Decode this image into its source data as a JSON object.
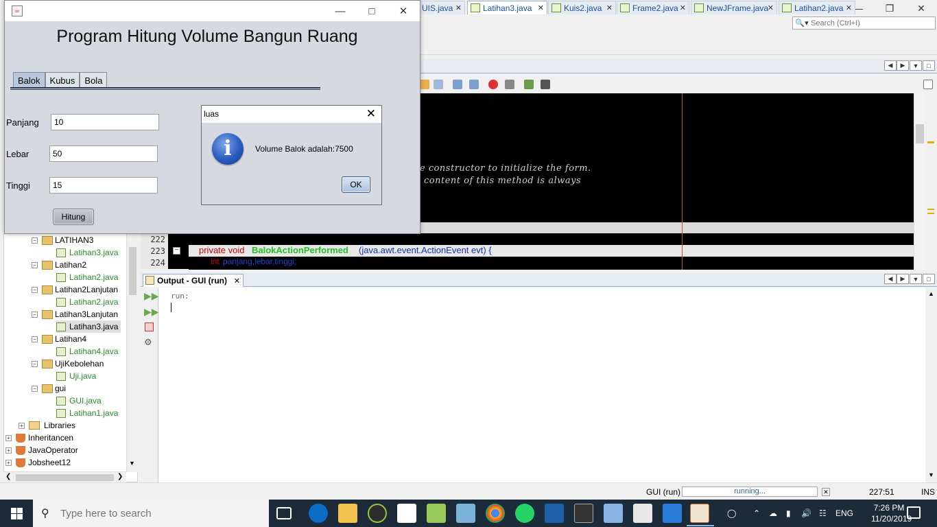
{
  "ide": {
    "search_placeholder": "Search (Ctrl+I)",
    "editor_tabs": [
      {
        "label": "UIS.java"
      },
      {
        "label": "Latihan3.java"
      },
      {
        "label": "Kuis2.java"
      },
      {
        "label": "Frame2.java"
      },
      {
        "label": "NewJFrame.java"
      },
      {
        "label": "Latihan2.java"
      }
    ],
    "code_comments": [
      "e constructor to initialize the form.",
      "content of this method is always"
    ],
    "line_numbers": [
      "222",
      "223",
      "224"
    ],
    "code_line_223": {
      "kw": "private void ",
      "method": "BalokActionPerformed",
      "rest": "(java.awt.event.ActionEvent evt) {"
    },
    "code_line_224": {
      "kw": "int ",
      "rest": "panjang,lebar,tinggi;"
    },
    "output_tab": "Output - GUI (run)",
    "output_text": "run:",
    "project_tree": [
      {
        "label": "LATIHAN3",
        "kind": "package"
      },
      {
        "label": "Latihan3.java",
        "kind": "file"
      },
      {
        "label": "Latihan2",
        "kind": "package"
      },
      {
        "label": "Latihan2.java",
        "kind": "file"
      },
      {
        "label": "Latihan2Lanjutan",
        "kind": "package"
      },
      {
        "label": "Latihan2.java",
        "kind": "file"
      },
      {
        "label": "Latihan3Lanjutan",
        "kind": "package"
      },
      {
        "label": "Latihan3.java",
        "kind": "file-selected"
      },
      {
        "label": "Latihan4",
        "kind": "package"
      },
      {
        "label": "Latihan4.java",
        "kind": "file"
      },
      {
        "label": "UjiKebolehan",
        "kind": "package"
      },
      {
        "label": "Uji.java",
        "kind": "file"
      },
      {
        "label": "gui",
        "kind": "package"
      },
      {
        "label": "GUI.java",
        "kind": "file"
      },
      {
        "label": "Latihan1.java",
        "kind": "file"
      },
      {
        "label": "Libraries",
        "kind": "library"
      },
      {
        "label": "Inheritancen",
        "kind": "project"
      },
      {
        "label": "JavaOperator",
        "kind": "project"
      },
      {
        "label": "Jobsheet12",
        "kind": "project"
      }
    ],
    "status": {
      "task": "GUI (run)",
      "progress": "running...",
      "position": "227:51",
      "mode": "INS"
    }
  },
  "app": {
    "title": "Program Hitung Volume Bangun Ruang",
    "tabs": [
      "Balok",
      "Kubus",
      "Bola"
    ],
    "active_tab": "Balok",
    "fields": {
      "panjang_label": "Panjang",
      "panjang_value": "10",
      "lebar_label": "Lebar",
      "lebar_value": "50",
      "tinggi_label": "Tinggi",
      "tinggi_value": "15"
    },
    "hitung_label": "Hitung"
  },
  "dialog": {
    "title": "luas",
    "message": "Volume Balok adalah:7500",
    "ok_label": "OK"
  },
  "taskbar": {
    "search_placeholder": "Type here to search",
    "language": "ENG",
    "time": "7:26 PM",
    "date": "11/20/2019"
  }
}
